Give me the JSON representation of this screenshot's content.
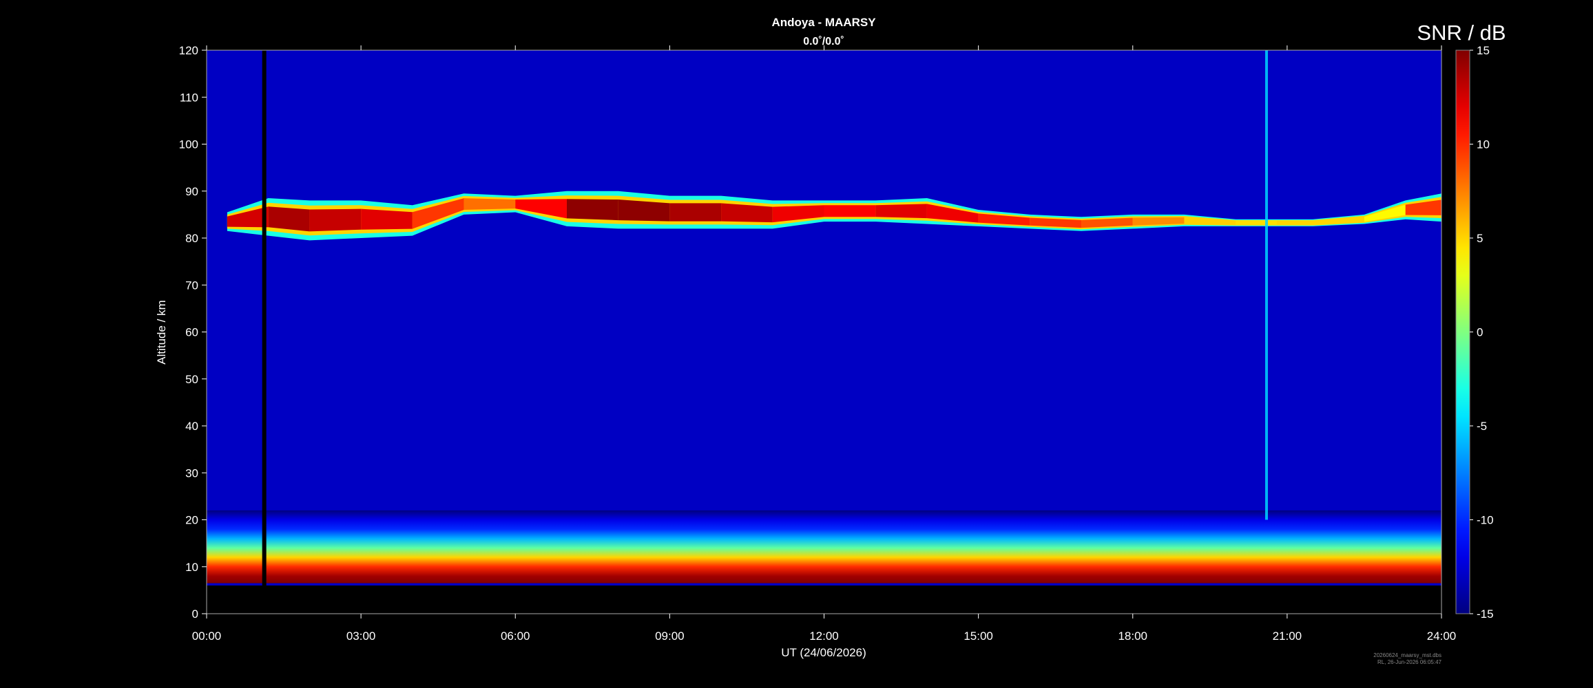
{
  "chart_data": {
    "type": "heatmap",
    "title": "Andoya - MAARSY",
    "subtitle": "0.0˚/0.0˚",
    "xlabel": "UT (24/06/2026)",
    "ylabel": "Altitude / km",
    "x_ticks": [
      "00:00",
      "03:00",
      "06:00",
      "09:00",
      "12:00",
      "15:00",
      "18:00",
      "21:00",
      "24:00"
    ],
    "y_ticks": [
      0,
      10,
      20,
      30,
      40,
      50,
      60,
      70,
      80,
      90,
      100,
      110,
      120
    ],
    "xlim_hours": [
      0,
      24
    ],
    "ylim": [
      0,
      120
    ],
    "data_lower_altitude_km": 6,
    "colorbar": {
      "label": "SNR / dB",
      "range": [
        -15,
        15
      ],
      "ticks": [
        15,
        10,
        5,
        0,
        -5,
        -10,
        -15
      ],
      "colormap": "jet"
    },
    "data_gap_hours": [
      1.08,
      1.16
    ],
    "pmse_layer": [
      {
        "hour": 0.4,
        "top_km": 85.5,
        "bottom_km": 81.5,
        "intensity": 0.75
      },
      {
        "hour": 1.2,
        "top_km": 88.5,
        "bottom_km": 80.5,
        "intensity": 0.95
      },
      {
        "hour": 2.0,
        "top_km": 88.0,
        "bottom_km": 79.5,
        "intensity": 0.9
      },
      {
        "hour": 3.0,
        "top_km": 88.0,
        "bottom_km": 80.0,
        "intensity": 0.85
      },
      {
        "hour": 4.0,
        "top_km": 87.0,
        "bottom_km": 80.5,
        "intensity": 0.8
      },
      {
        "hour": 5.0,
        "top_km": 89.5,
        "bottom_km": 85.0,
        "intensity": 0.55
      },
      {
        "hour": 6.0,
        "top_km": 89.0,
        "bottom_km": 85.5,
        "intensity": 0.6
      },
      {
        "hour": 7.0,
        "top_km": 90.0,
        "bottom_km": 82.5,
        "intensity": 0.95
      },
      {
        "hour": 8.0,
        "top_km": 90.0,
        "bottom_km": 82.0,
        "intensity": 1.0
      },
      {
        "hour": 9.0,
        "top_km": 89.0,
        "bottom_km": 82.0,
        "intensity": 0.95
      },
      {
        "hour": 10.0,
        "top_km": 89.0,
        "bottom_km": 82.0,
        "intensity": 0.9
      },
      {
        "hour": 11.0,
        "top_km": 88.0,
        "bottom_km": 82.0,
        "intensity": 0.85
      },
      {
        "hour": 12.0,
        "top_km": 88.0,
        "bottom_km": 83.5,
        "intensity": 0.75
      },
      {
        "hour": 13.0,
        "top_km": 88.0,
        "bottom_km": 83.5,
        "intensity": 0.8
      },
      {
        "hour": 14.0,
        "top_km": 88.5,
        "bottom_km": 83.0,
        "intensity": 0.85
      },
      {
        "hour": 15.0,
        "top_km": 86.0,
        "bottom_km": 82.5,
        "intensity": 0.75
      },
      {
        "hour": 16.0,
        "top_km": 85.0,
        "bottom_km": 82.0,
        "intensity": 0.7
      },
      {
        "hour": 17.0,
        "top_km": 84.5,
        "bottom_km": 81.5,
        "intensity": 0.65
      },
      {
        "hour": 18.0,
        "top_km": 85.0,
        "bottom_km": 82.0,
        "intensity": 0.6
      },
      {
        "hour": 19.0,
        "top_km": 85.0,
        "bottom_km": 82.5,
        "intensity": 0.45
      },
      {
        "hour": 20.0,
        "top_km": 84.0,
        "bottom_km": 82.5,
        "intensity": 0.35
      },
      {
        "hour": 20.8,
        "top_km": 84.0,
        "bottom_km": 82.5,
        "intensity": 0.4
      },
      {
        "hour": 21.5,
        "top_km": 84.0,
        "bottom_km": 82.5,
        "intensity": 0.15
      },
      {
        "hour": 22.5,
        "top_km": 85.0,
        "bottom_km": 83.0,
        "intensity": 0.1
      },
      {
        "hour": 23.3,
        "top_km": 88.0,
        "bottom_km": 84.0,
        "intensity": 0.55
      },
      {
        "hour": 24.0,
        "top_km": 89.5,
        "bottom_km": 83.5,
        "intensity": 0.8
      }
    ],
    "low_altitude_echo": [
      {
        "altitude_km": 6.5,
        "snr_db": 15
      },
      {
        "altitude_km": 8,
        "snr_db": 14
      },
      {
        "altitude_km": 10,
        "snr_db": 10
      },
      {
        "altitude_km": 12,
        "snr_db": 5
      },
      {
        "altitude_km": 14,
        "snr_db": -1
      },
      {
        "altitude_km": 16,
        "snr_db": -6
      },
      {
        "altitude_km": 18,
        "snr_db": -10
      },
      {
        "altitude_km": 20,
        "snr_db": -12
      },
      {
        "altitude_km": 22,
        "snr_db": -15
      }
    ],
    "background_snr_db": -13,
    "vertical_streak": {
      "hour": 20.6,
      "top_km": 120,
      "bottom_km": 20
    }
  },
  "footer": {
    "line1": "20260624_maarsy_mst.dbs",
    "line2": "RL, 26-Jun-2026 06:05:47"
  }
}
